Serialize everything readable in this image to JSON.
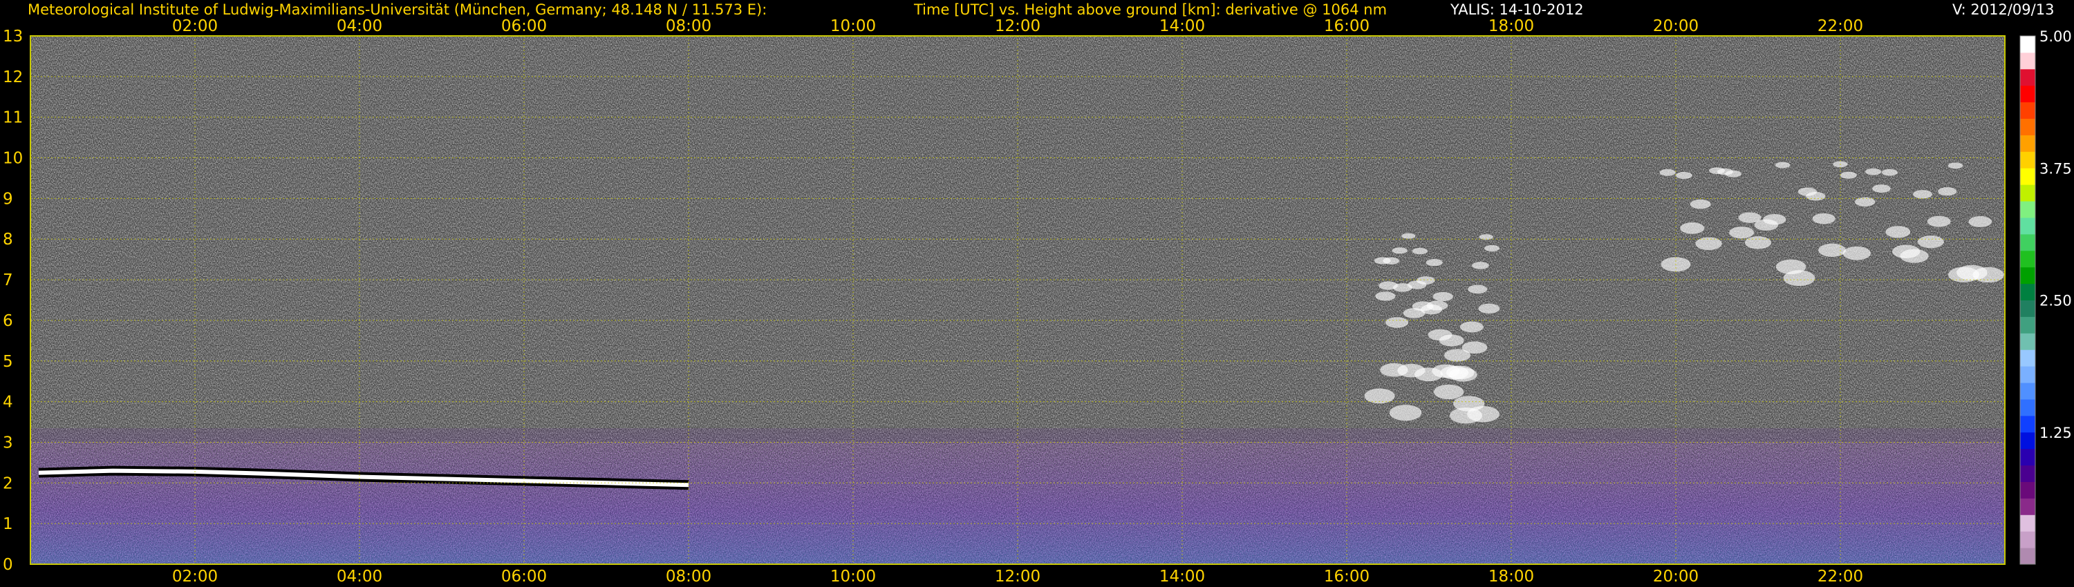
{
  "header": {
    "institution": "Meteorological Institute of Ludwig-Maximilians-Universität (München, Germany; 48.148 N / 11.573 E):",
    "title": "Time [UTC] vs. Height above ground [km]: derivative @ 1064 nm",
    "station": "YALIS: 14-10-2012",
    "version": "V: 2012/09/13"
  },
  "colors": {
    "background": "#000000",
    "grid": "#c8c800",
    "axis_text": "#ffd400",
    "header_white": "#ffffff"
  },
  "chart_data": {
    "type": "heatmap",
    "title": "Time [UTC] vs. Height above ground [km]: derivative @ 1064 nm",
    "xlabel": "",
    "ylabel": "",
    "x_range_hours": [
      0,
      24
    ],
    "x_ticks": [
      "02:00",
      "04:00",
      "06:00",
      "08:00",
      "10:00",
      "12:00",
      "14:00",
      "16:00",
      "18:00",
      "20:00",
      "22:00"
    ],
    "x_tick_hours": [
      2,
      4,
      6,
      8,
      10,
      12,
      14,
      16,
      18,
      20,
      22
    ],
    "ylim": [
      0,
      13
    ],
    "y_ticks": [
      0,
      1,
      2,
      3,
      4,
      5,
      6,
      7,
      8,
      9,
      10,
      11,
      12,
      13
    ],
    "grid": true,
    "colorbar": {
      "range": [
        0,
        5
      ],
      "ticks": [
        "1.25",
        "2.50",
        "3.75",
        "5.00"
      ],
      "tick_values": [
        1.25,
        2.5,
        3.75,
        5.0
      ],
      "colors": [
        "#b08ab0",
        "#c8a0c8",
        "#e0c0e0",
        "#8a2a8a",
        "#6a0a7a",
        "#4a0090",
        "#2a00b0",
        "#0010e0",
        "#1040ff",
        "#3070ff",
        "#5090ff",
        "#7ab0ff",
        "#98c8ff",
        "#70c0b0",
        "#40a080",
        "#208060",
        "#008040",
        "#00a000",
        "#20c020",
        "#40d060",
        "#60e0a0",
        "#80f080",
        "#c0f000",
        "#ffff00",
        "#ffd000",
        "#ffa000",
        "#ff7000",
        "#ff4000",
        "#ff0000",
        "#e01030",
        "#ffd0d8",
        "#ffffff"
      ]
    },
    "features": [
      {
        "kind": "boundary_layer_top",
        "hours": [
          0.1,
          1.0,
          2.0,
          3.0,
          4.0,
          5.0,
          6.0,
          7.0,
          8.0
        ],
        "height_km": [
          2.25,
          2.3,
          2.28,
          2.22,
          2.15,
          2.1,
          2.05,
          2.0,
          1.95
        ]
      },
      {
        "kind": "cloud",
        "hours": [
          16.4,
          17.8
        ],
        "height_km": [
          3.5,
          8.1
        ]
      },
      {
        "kind": "cloud",
        "hours": [
          19.9,
          23.9
        ],
        "height_km": [
          6.8,
          10.0
        ]
      }
    ]
  }
}
